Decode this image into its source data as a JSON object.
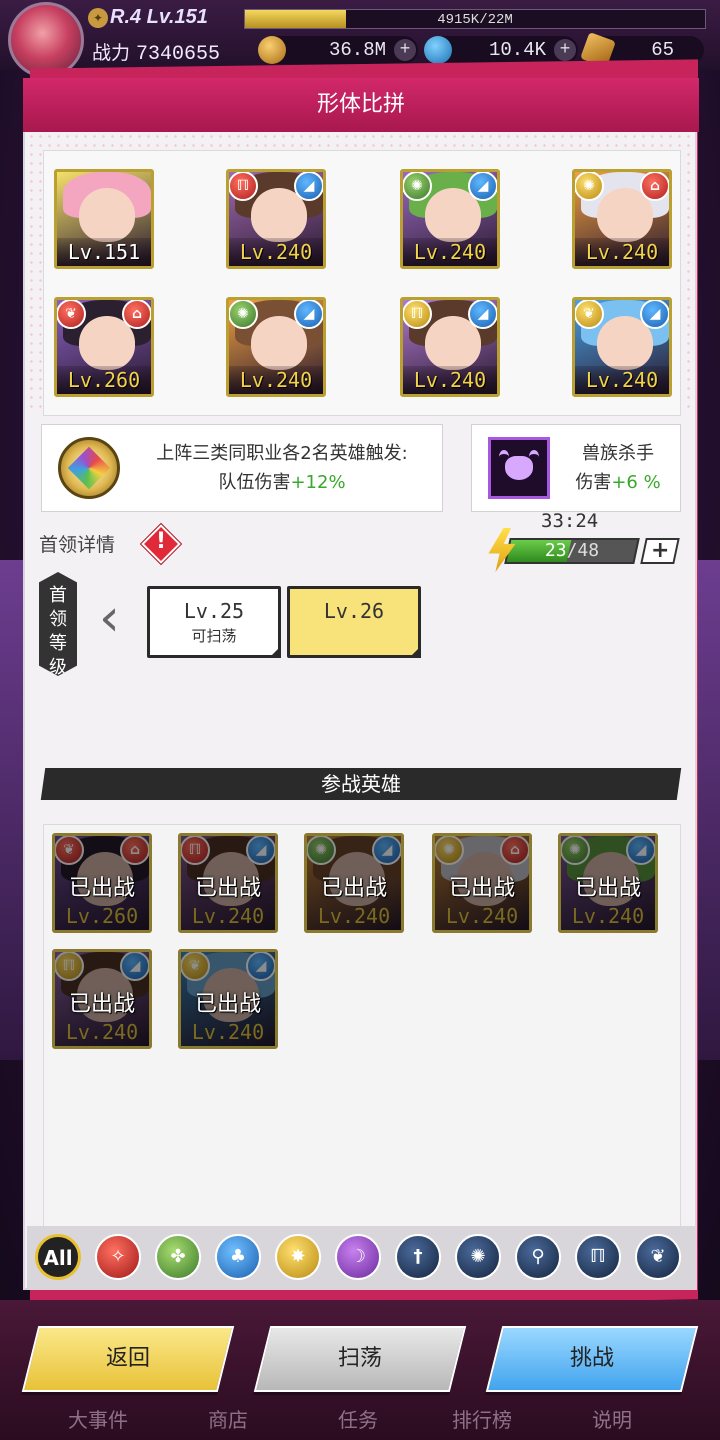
{
  "player": {
    "rank_level": "R.4 Lv.151",
    "exp_text": "4915K/22M",
    "exp_fraction": 0.22,
    "power_label": "战力",
    "power_value": "7340655"
  },
  "resources": [
    {
      "icon": "gold-coin-icon",
      "value": "36.8M"
    },
    {
      "icon": "blue-gem-icon",
      "value": "10.4K"
    },
    {
      "icon": "amber-crystal-icon",
      "value": "65"
    }
  ],
  "dialog": {
    "title": "形体比拼"
  },
  "team": [
    {
      "level": "Lv.151",
      "badges": [],
      "hair": "#f4a6c0",
      "bg": "#f4e06a",
      "lvl_color": "white"
    },
    {
      "level": "Lv.240",
      "badges": [
        {
          "side": "l",
          "color": "red",
          "icon": "rune-icon"
        },
        {
          "side": "r",
          "color": "blue",
          "icon": "wave-icon"
        }
      ],
      "hair": "#5a3a2a",
      "bg": "#a06ab0"
    },
    {
      "level": "Lv.240",
      "badges": [
        {
          "side": "l",
          "color": "green",
          "icon": "swirl-icon"
        },
        {
          "side": "r",
          "color": "blue",
          "icon": "wave-icon"
        }
      ],
      "hair": "#6ab04a",
      "bg": "#9a6ac0"
    },
    {
      "level": "Lv.240",
      "badges": [
        {
          "side": "l",
          "color": "yellow",
          "icon": "swirl-icon"
        },
        {
          "side": "r",
          "color": "red",
          "icon": "helmet-icon"
        }
      ],
      "hair": "#e4e4ee",
      "bg": "#f0a040"
    },
    {
      "level": "Lv.260",
      "badges": [
        {
          "side": "l",
          "color": "red",
          "icon": "wings-icon"
        },
        {
          "side": "r",
          "color": "red",
          "icon": "helmet-icon"
        }
      ],
      "hair": "#2a2030",
      "bg": "#8a60c0"
    },
    {
      "level": "Lv.240",
      "badges": [
        {
          "side": "l",
          "color": "green",
          "icon": "swirl-icon"
        },
        {
          "side": "r",
          "color": "blue",
          "icon": "wave-icon"
        }
      ],
      "hair": "#7a5034",
      "bg": "#f0a040"
    },
    {
      "level": "Lv.240",
      "badges": [
        {
          "side": "l",
          "color": "yellow",
          "icon": "rune-icon"
        },
        {
          "side": "r",
          "color": "blue",
          "icon": "wave-icon"
        }
      ],
      "hair": "#5a3a2a",
      "bg": "#b07ad0"
    },
    {
      "level": "Lv.240",
      "badges": [
        {
          "side": "l",
          "color": "yellow",
          "icon": "wings-icon"
        },
        {
          "side": "r",
          "color": "blue",
          "icon": "wave-icon"
        }
      ],
      "hair": "#7ac0f0",
      "bg": "#4aa0e0"
    }
  ],
  "bonus_left": {
    "line1": "上阵三类同职业各2名英雄触发:",
    "line2_prefix": "队伍伤害",
    "line2_value": "+12%"
  },
  "bonus_right": {
    "line1": "兽族杀手",
    "line2_prefix": "伤害",
    "line2_value": "+6 %"
  },
  "boss": {
    "label": "首领详情",
    "warn_glyph": "!",
    "level_tab": "首领等级",
    "timer": "33:24",
    "stamina_current": "23",
    "stamina_max": "/48",
    "stamina_fraction": 0.479,
    "stamina_plus": "+",
    "prev_arrow": "‹",
    "levels": [
      {
        "level": "Lv.25",
        "sub": "可扫荡"
      },
      {
        "level": "Lv.26",
        "sub": ""
      }
    ]
  },
  "participating": {
    "title": "参战英雄",
    "used_label": "已出战",
    "heroes": [
      {
        "level": "Lv.260",
        "badges": [
          {
            "side": "l",
            "color": "red",
            "icon": "wings-icon"
          },
          {
            "side": "r",
            "color": "red",
            "icon": "helmet-icon"
          }
        ],
        "hair": "#2a2030",
        "bg": "#8a60c0"
      },
      {
        "level": "Lv.240",
        "badges": [
          {
            "side": "l",
            "color": "red",
            "icon": "rune-icon"
          },
          {
            "side": "r",
            "color": "blue",
            "icon": "wave-icon"
          }
        ],
        "hair": "#5a3a2a",
        "bg": "#a06ab0"
      },
      {
        "level": "Lv.240",
        "badges": [
          {
            "side": "l",
            "color": "green",
            "icon": "swirl-icon"
          },
          {
            "side": "r",
            "color": "blue",
            "icon": "wave-icon"
          }
        ],
        "hair": "#7a5034",
        "bg": "#f0a040"
      },
      {
        "level": "Lv.240",
        "badges": [
          {
            "side": "l",
            "color": "yellow",
            "icon": "swirl-icon"
          },
          {
            "side": "r",
            "color": "red",
            "icon": "helmet-icon"
          }
        ],
        "hair": "#e4e4ee",
        "bg": "#f0a040"
      },
      {
        "level": "Lv.240",
        "badges": [
          {
            "side": "l",
            "color": "green",
            "icon": "swirl-icon"
          },
          {
            "side": "r",
            "color": "blue",
            "icon": "wave-icon"
          }
        ],
        "hair": "#6ab04a",
        "bg": "#9a6ac0"
      },
      {
        "level": "Lv.240",
        "badges": [
          {
            "side": "l",
            "color": "yellow",
            "icon": "rune-icon"
          },
          {
            "side": "r",
            "color": "blue",
            "icon": "wave-icon"
          }
        ],
        "hair": "#5a3a2a",
        "bg": "#b07ad0"
      },
      {
        "level": "Lv.240",
        "badges": [
          {
            "side": "l",
            "color": "yellow",
            "icon": "wings-icon"
          },
          {
            "side": "r",
            "color": "blue",
            "icon": "wave-icon"
          }
        ],
        "hair": "#7ac0f0",
        "bg": "#4aa0e0"
      }
    ]
  },
  "filters": [
    {
      "label": "All",
      "color": "all",
      "icon": "all-icon"
    },
    {
      "label": "",
      "color": "red",
      "icon": "fire-element-icon"
    },
    {
      "label": "",
      "color": "green",
      "icon": "leaf-element-icon"
    },
    {
      "label": "",
      "color": "blue",
      "icon": "water-element-icon"
    },
    {
      "label": "",
      "color": "yellow",
      "icon": "light-element-icon"
    },
    {
      "label": "",
      "color": "purple",
      "icon": "dark-element-icon"
    },
    {
      "label": "",
      "color": "navy",
      "icon": "sword-class-icon"
    },
    {
      "label": "",
      "color": "navy",
      "icon": "swirl-class-icon"
    },
    {
      "label": "",
      "color": "navy",
      "icon": "staff-class-icon"
    },
    {
      "label": "",
      "color": "navy",
      "icon": "rune-class-icon"
    },
    {
      "label": "",
      "color": "navy",
      "icon": "wings-class-icon"
    }
  ],
  "actions": {
    "back": "返回",
    "sweep": "扫荡",
    "challenge": "挑战"
  },
  "bottom_nav": [
    "大事件",
    "商店",
    "任务",
    "排行榜",
    "说明"
  ]
}
